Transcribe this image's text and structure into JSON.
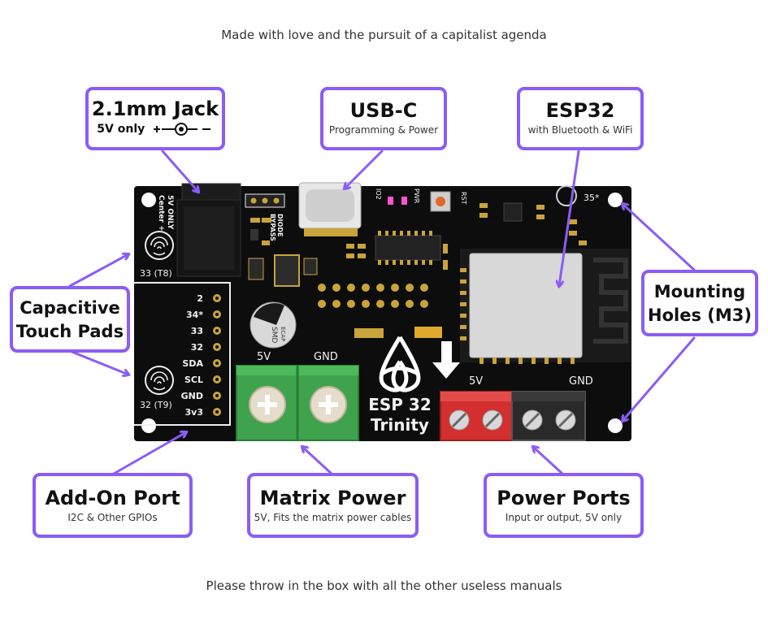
{
  "captions": {
    "top": "Made with love and the pursuit of a capitalist agenda",
    "bottom": "Please throw in the box with all the other useless manuals"
  },
  "callouts": {
    "jack": {
      "title": "2.1mm Jack",
      "sub": "5V only"
    },
    "usbc": {
      "title": "USB-C",
      "sub": "Programming & Power"
    },
    "esp32": {
      "title": "ESP32",
      "sub": "with Bluetooth & WiFi"
    },
    "touch": {
      "line1": "Capacitive",
      "line2": "Touch Pads"
    },
    "mounting": {
      "line1": "Mounting",
      "line2": "Holes (M3)"
    },
    "addon": {
      "title": "Add-On Port",
      "sub": "I2C & Other GPIOs"
    },
    "matrix": {
      "title": "Matrix Power",
      "sub": "5V, Fits the matrix power cables"
    },
    "power": {
      "title": "Power Ports",
      "sub": "Input or output, 5V only"
    }
  },
  "board": {
    "jack_label": [
      "5V ONLY",
      "Center +"
    ],
    "diode_label": [
      "DIODE",
      "BYPASS"
    ],
    "led_labels": [
      "IO2",
      "PWR"
    ],
    "rst_label": "RST",
    "pin35_label": "35*",
    "touch_t8": "33 (T8)",
    "touch_t9": "32 (T9)",
    "header_pins": [
      "2",
      "34*",
      "33",
      "32",
      "SDA",
      "SCL",
      "GND",
      "3v3"
    ],
    "terminal_left": [
      "5V",
      "GND"
    ],
    "terminal_right": [
      "5V",
      "GND"
    ],
    "cap_label": "SMD",
    "cap_label2": "ECAP",
    "logo_line1": "ESP 32",
    "logo_line2": "Trinity"
  },
  "colors": {
    "accent": "#8b5cf6",
    "pcb": "#0d0d0d",
    "green_terminal": "#3fa34d",
    "red_terminal": "#d32f2f",
    "black_terminal": "#2a2a2a",
    "gold": "#c9a43a"
  }
}
